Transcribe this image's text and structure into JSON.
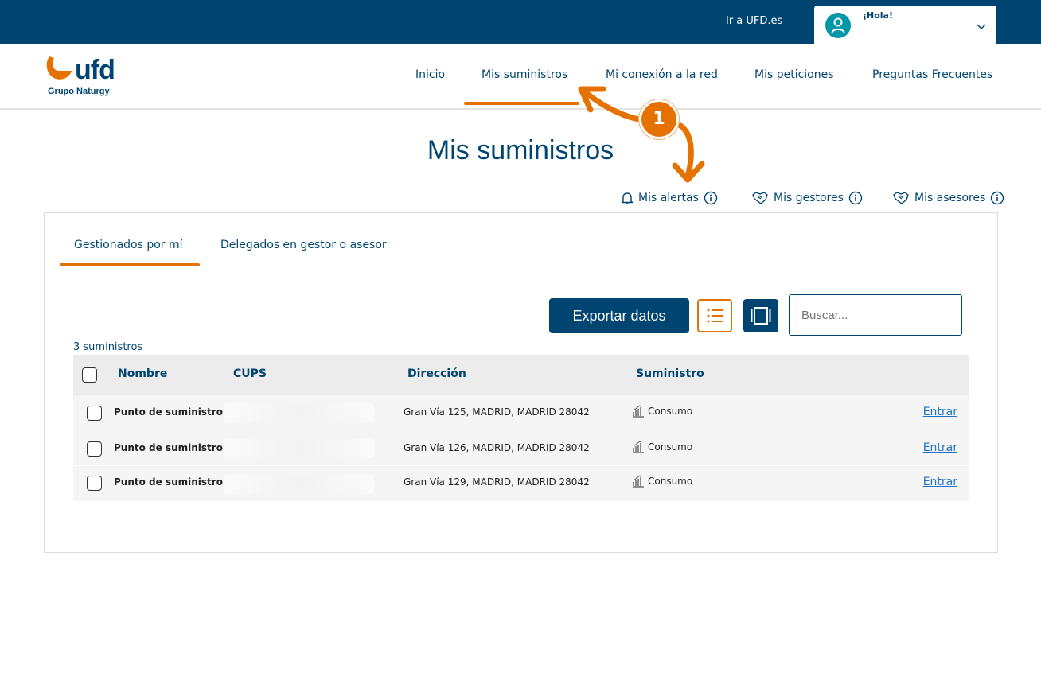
{
  "topbar": {
    "ufd_link": "Ir a UFD.es",
    "greeting": "¡Hola!"
  },
  "logo": {
    "word": "ufd",
    "sub": "Grupo Naturgy"
  },
  "nav": {
    "items": [
      {
        "label": "Inicio"
      },
      {
        "label": "Mis suministros"
      },
      {
        "label": "Mi conexión a la red"
      },
      {
        "label": "Mis peticiones"
      },
      {
        "label": "Preguntas Frecuentes"
      }
    ],
    "active": "Mis suministros"
  },
  "page_title": "Mis suministros",
  "annotation": {
    "step": "1"
  },
  "quick_links": [
    {
      "label": "Mis alertas",
      "icon": "bell-icon"
    },
    {
      "label": "Mis gestores",
      "icon": "handshake-icon"
    },
    {
      "label": "Mis asesores",
      "icon": "handshake-icon"
    }
  ],
  "tabs": [
    {
      "label": "Gestionados por mí"
    },
    {
      "label": "Delegados en gestor o asesor"
    }
  ],
  "toolbar": {
    "export_label": "Exportar datos",
    "search_placeholder": "Buscar..."
  },
  "count_label": "3 suministros",
  "table": {
    "headers": {
      "name": "Nombre",
      "cups": "CUPS",
      "address": "Dirección",
      "supply": "Suministro"
    },
    "rows": [
      {
        "name": "Punto de suministro",
        "address": "Gran Vía 125, MADRID, MADRID 28042",
        "supply": "Consumo",
        "action": "Entrar"
      },
      {
        "name": "Punto de suministro",
        "address": "Gran Vía 126, MADRID, MADRID 28042",
        "supply": "Consumo",
        "action": "Entrar"
      },
      {
        "name": "Punto de suministro",
        "address": "Gran Vía 129, MADRID, MADRID 28042",
        "supply": "Consumo",
        "action": "Entrar"
      }
    ]
  },
  "colors": {
    "brand_blue": "#004571",
    "accent_orange": "#e57200",
    "link_blue": "#1f74c9"
  }
}
